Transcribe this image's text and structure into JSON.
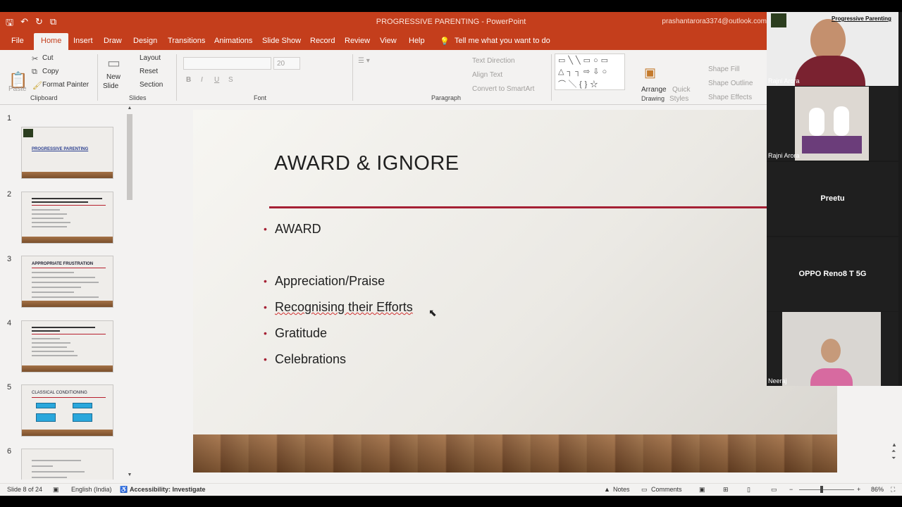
{
  "window": {
    "title": "PROGRESSIVE PARENTING  -  PowerPoint",
    "account": "prashantarora3374@outlook.com"
  },
  "tabs": [
    "File",
    "Home",
    "Insert",
    "Draw",
    "Design",
    "Transitions",
    "Animations",
    "Slide Show",
    "Record",
    "Review",
    "View",
    "Help"
  ],
  "active_tab": "Home",
  "tell_me": "Tell me what you want to do",
  "ribbon": {
    "clipboard": {
      "paste": "Paste",
      "cut": "Cut",
      "copy": "Copy",
      "format_painter": "Format Painter",
      "label": "Clipboard"
    },
    "slides": {
      "new_slide_1": "New",
      "new_slide_2": "Slide",
      "layout": "Layout",
      "reset": "Reset",
      "section": "Section",
      "label": "Slides"
    },
    "font": {
      "size": "20",
      "label": "Font"
    },
    "paragraph": {
      "text_direction": "Text Direction",
      "align_text": "Align Text",
      "smartart": "Convert to SmartArt",
      "label": "Paragraph"
    },
    "drawing": {
      "arrange": "Arrange",
      "quick_styles_1": "Quick",
      "quick_styles_2": "Styles",
      "shape_fill": "Shape Fill",
      "shape_outline": "Shape Outline",
      "shape_effects": "Shape Effects",
      "label": "Drawing"
    }
  },
  "thumbnails": [
    {
      "num": "1",
      "title": "PROGRESSIVE PARENTING"
    },
    {
      "num": "2"
    },
    {
      "num": "3",
      "title": "APPROPRIATE FRUSTRATION"
    },
    {
      "num": "4"
    },
    {
      "num": "5",
      "title": "CLASSICAL CONDITIONING"
    },
    {
      "num": "6"
    }
  ],
  "slide": {
    "title": "AWARD & IGNORE",
    "bullets": [
      "AWARD",
      "Appreciation/Praise",
      "Recognising their Efforts",
      "Gratitude",
      "Celebrations"
    ]
  },
  "video": {
    "speaker_caption": "Progressive Parenting",
    "participants": [
      "Rajni Arora",
      "Rajni Arora",
      "Preetu",
      "OPPO Reno8 T 5G",
      "Neeraj"
    ]
  },
  "statusbar": {
    "slide_info": "Slide 8 of 24",
    "language": "English (India)",
    "accessibility": "Accessibility: Investigate",
    "notes": "Notes",
    "comments": "Comments",
    "zoom": "86%"
  },
  "colors": {
    "accent": "#c43e1c",
    "rule": "#a52034"
  }
}
